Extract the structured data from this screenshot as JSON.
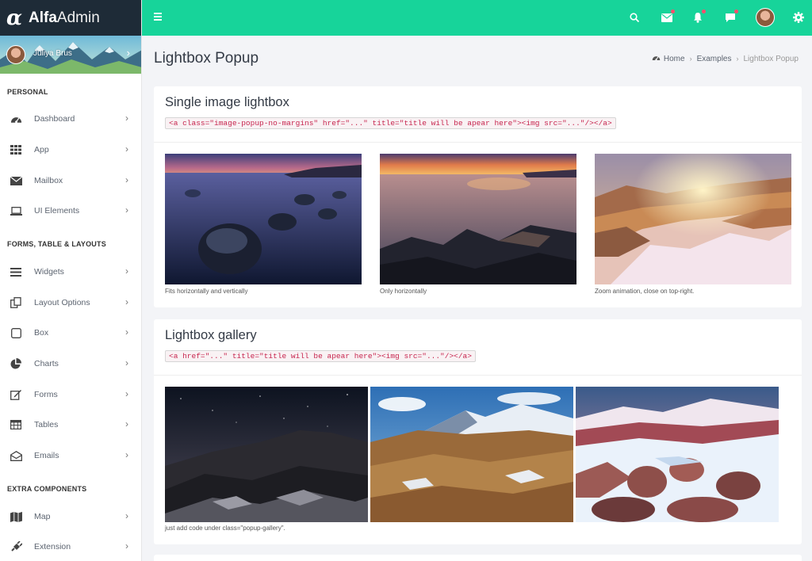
{
  "app": {
    "brand_bold": "Alfa",
    "brand_light": "Admin"
  },
  "user": {
    "name": "Juliya Brus"
  },
  "sidebar": {
    "sections": [
      {
        "header": "PERSONAL",
        "items": [
          {
            "label": "Dashboard",
            "icon": "dashboard-icon"
          },
          {
            "label": "App",
            "icon": "grid-icon"
          },
          {
            "label": "Mailbox",
            "icon": "envelope-icon"
          },
          {
            "label": "UI Elements",
            "icon": "laptop-icon"
          }
        ]
      },
      {
        "header": "FORMS, TABLE & LAYOUTS",
        "items": [
          {
            "label": "Widgets",
            "icon": "bars-icon"
          },
          {
            "label": "Layout Options",
            "icon": "copy-icon"
          },
          {
            "label": "Box",
            "icon": "square-icon"
          },
          {
            "label": "Charts",
            "icon": "pie-chart-icon"
          },
          {
            "label": "Forms",
            "icon": "edit-icon"
          },
          {
            "label": "Tables",
            "icon": "table-icon"
          },
          {
            "label": "Emails",
            "icon": "envelope-open-icon"
          }
        ]
      },
      {
        "header": "EXTRA COMPONENTS",
        "items": [
          {
            "label": "Map",
            "icon": "map-icon"
          },
          {
            "label": "Extension",
            "icon": "plug-icon"
          }
        ]
      }
    ]
  },
  "topbar": {
    "icons": [
      "menu-icon",
      "search-icon",
      "envelope-icon",
      "bell-icon",
      "chat-icon",
      "avatar",
      "gear-icon"
    ],
    "accent": "#17d49a"
  },
  "page": {
    "title": "Lightbox Popup",
    "breadcrumb": [
      "Home",
      "Examples",
      "Lightbox Popup"
    ]
  },
  "single_lightbox": {
    "title": "Single image lightbox",
    "code": "<a class=\"image-popup-no-margins\" href=\"...\" title=\"title will be apear here\"><img src=\"...\"/></a>",
    "images": [
      {
        "caption": "Fits horizontally and vertically"
      },
      {
        "caption": "Only horizontally"
      },
      {
        "caption": "Zoom animation, close on top-right."
      }
    ]
  },
  "gallery": {
    "title": "Lightbox gallery",
    "code": "<a href=\"...\" title=\"title will be apear here\"><img src=\"...\"/></a>",
    "caption": "just add code under class=\"popup-gallery\"."
  },
  "colors": {
    "sidebar_dark": "#1e2b37",
    "code_text": "#c7254e",
    "notify_dot": "#ff4d6d"
  }
}
